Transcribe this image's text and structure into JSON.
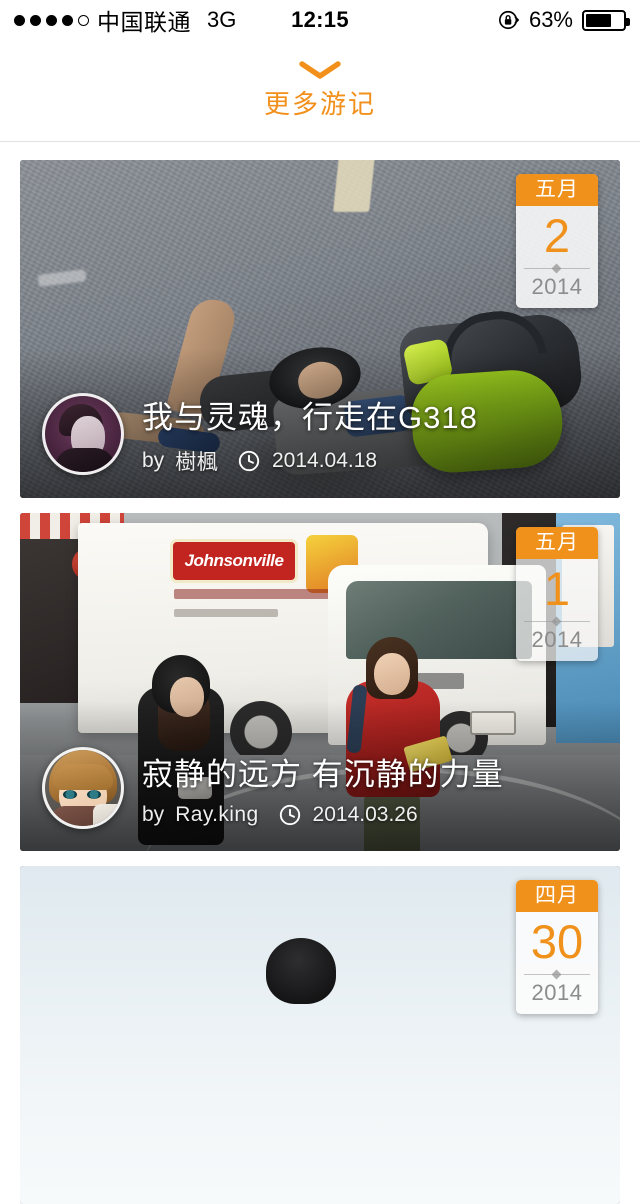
{
  "status_bar": {
    "signal_dots_total": 5,
    "signal_dots_filled": 4,
    "carrier": "中国联通",
    "network": "3G",
    "time": "12:15",
    "battery_percent": "63%",
    "battery_level": 63,
    "rotation_lock_icon": "rotation-lock-icon"
  },
  "header": {
    "chevron_icon": "chevron-down-icon",
    "more_label": "更多游记",
    "accent_color": "#F2901C"
  },
  "feed": {
    "cards": [
      {
        "title": "我与灵魂，行走在G318",
        "author_prefix": "by",
        "author": "樹楓",
        "date": "2014.04.18",
        "clock_icon": "clock-icon",
        "avatar_name": "avatar-shufeng",
        "badge": {
          "month": "五月",
          "day": "2",
          "year": "2014"
        },
        "photo_name": "photo-person-lying-on-road"
      },
      {
        "title": "寂静的远方 有沉静的力量",
        "author_prefix": "by",
        "author": "Ray.king",
        "date": "2014.03.26",
        "clock_icon": "clock-icon",
        "avatar_name": "avatar-rayking",
        "badge": {
          "month": "五月",
          "day": "1",
          "year": "2014"
        },
        "photo_name": "photo-street-scene-truck"
      },
      {
        "title": "",
        "author_prefix": "",
        "author": "",
        "date": "",
        "clock_icon": "clock-icon",
        "avatar_name": "avatar-third",
        "badge": {
          "month": "四月",
          "day": "30",
          "year": "2014"
        },
        "photo_name": "photo-sky-silhouette"
      }
    ]
  },
  "colors": {
    "accent_orange": "#F0911C",
    "badge_year_gray": "#8C8C8C",
    "page_background": "#FFFFFF"
  }
}
